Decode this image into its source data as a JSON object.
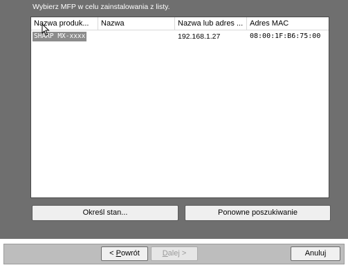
{
  "instruction": "Wybierz MFP w celu zainstalowania z listy.",
  "list": {
    "columns": [
      "Nazwa produk...",
      "Nazwa",
      "Nazwa lub adres ...",
      "Adres MAC"
    ],
    "rows": [
      {
        "product": "SHARP MX-xxxx",
        "name": "",
        "address": "192.168.1.27",
        "mac": "08:00:1F:B6:75:00",
        "selected": true
      }
    ]
  },
  "buttons": {
    "status": "Określ stan...",
    "research": "Ponowne poszukiwanie"
  },
  "nav": {
    "back_prefix": "< ",
    "back_hotkey": "P",
    "back_rest": "owrót",
    "next_hotkey": "D",
    "next_rest": "alej >",
    "cancel": "Anuluj"
  },
  "colors": {
    "background": "#6f6f6f",
    "selection": "#8c8c8c",
    "bottom_bar": "#bdbdbd"
  }
}
